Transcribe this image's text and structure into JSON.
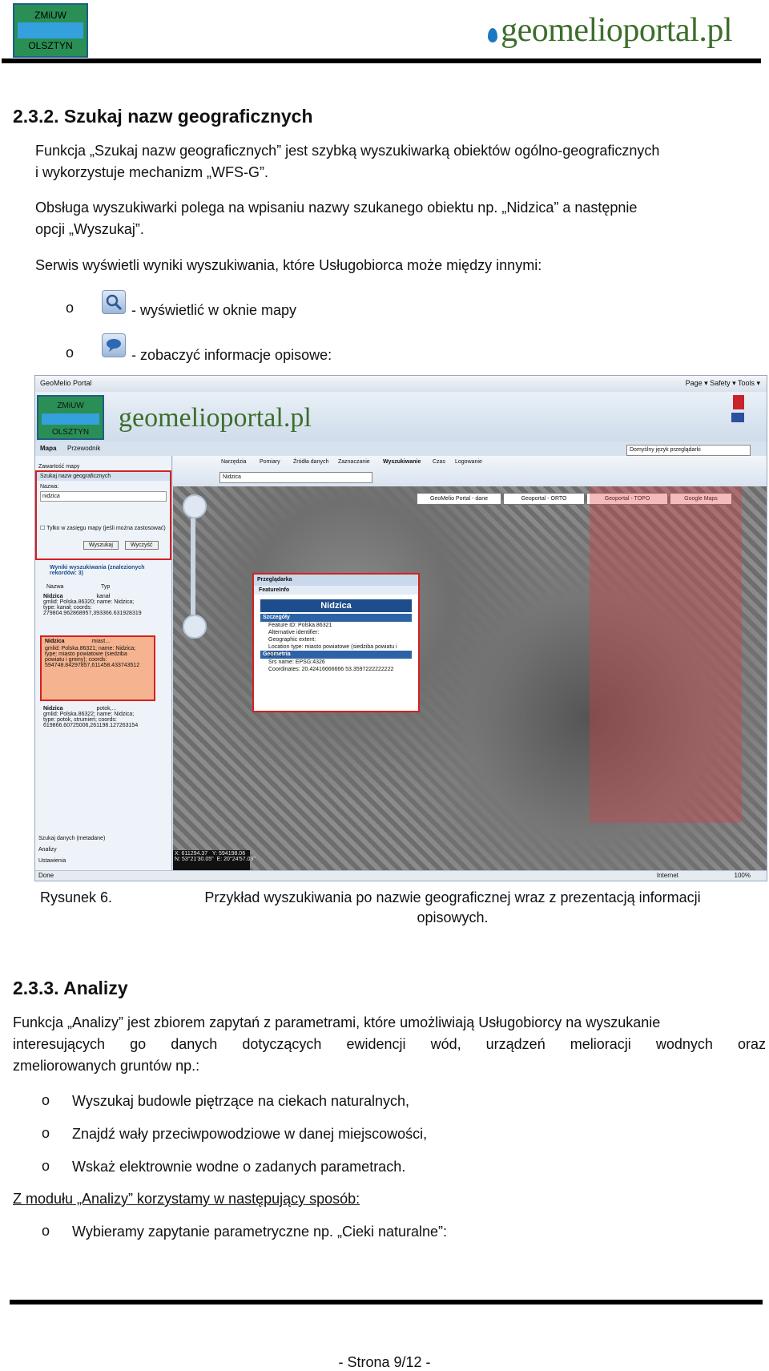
{
  "header": {
    "logo_line1": "ZMiUW",
    "logo_line2": "OLSZTYN",
    "brand": "geomelioportal.pl"
  },
  "section1": {
    "heading": "2.3.2. Szukaj nazw geograficznych",
    "para1_line1": "Funkcja „Szukaj nazw geograficznych” jest szybką wyszukiwarką obiektów ogólno-geograficznych",
    "para1_line2": "i wykorzystuje mechanizm „WFS-G”.",
    "para2_line1": "Obsługa wyszukiwarki polega na wpisaniu nazwy szukanego obiektu np. „Nidzica” a następnie",
    "para2_line2": "opcji „Wyszukaj”.",
    "para3": "Serwis wyświetli wyniki wyszukiwania, które Usługobiorca może między innymi:",
    "bullet_marker": "o",
    "bullet1": "- wyświetlić w oknie mapy",
    "bullet2": "- zobaczyć informacje opisowe:"
  },
  "figure": {
    "window_title": "GeoMelio Portal",
    "ie_menu": "Page ▾  Safety ▾  Tools ▾",
    "tab_map": "Mapa",
    "tab_guide": "Przewodnik",
    "toolbar_tabs": [
      "Narzędzia",
      "Pomiary",
      "Źródła danych",
      "Zaznaczanie",
      "Wyszukiwanie",
      "Czas",
      "Logowanie"
    ],
    "language": "Domyślny język przeglądarki",
    "search_value": "Nidzica",
    "sidebar_title1": "Zawartość mapy",
    "sidebar_title2": "Szukaj nazw geograficznych",
    "name_label": "Nazwa:",
    "name_value": "nidzica",
    "checkbox_label": "Tylko w zasięgu mapy (jeśli można zastosować)",
    "btn_search": "Wyszukaj",
    "btn_clear": "Wyczyść",
    "results_title": "Wyniki wyszukiwania (znalezionych rekordów: 3)",
    "col_name": "Nazwa",
    "col_type": "Typ",
    "results": [
      {
        "name": "Nidzica",
        "type": "kanał",
        "l1": "gmlid: Polska.86320; name: Nidzica;",
        "l2": "type: kanał; coords:",
        "l3": "279804.962868957,393366.631928319"
      },
      {
        "name": "Nidzica",
        "type": "miast...",
        "l1": "gmlid: Polska.86321; name: Nidzica;",
        "l2": "type: miasto powiatowe (siedziba",
        "l3": "powiatu i gminy); coords:",
        "l4": "594748.84297857,611458.433743512"
      },
      {
        "name": "Nidzica",
        "type": "potok,...",
        "l1": "gmlid: Polska.86322; name: Nidzica;",
        "l2": "type: potok, strumień; coords:",
        "l3": "619866.60725006,261198.127263154"
      }
    ],
    "sidebar_bottom": [
      "Szukaj danych (metadane)",
      "Analizy",
      "Ustawienia"
    ],
    "map_links": [
      "GeoMelio Portal - dane",
      "Geoportal - ORTO",
      "Geoportal - TOPO",
      "Google Maps"
    ],
    "popup_title": "Przeglądarka",
    "popup_tab": "FeatureInfo",
    "popup_feature": "Nidzica",
    "popup_sec1": "Szczegóły",
    "popup_rows1": [
      "Feature ID: Polska.86321",
      "Alternative identifier:",
      "Geographic extent:",
      "Location type: miasto powiatowe (siedziba powiatu i gminy)"
    ],
    "popup_sec2": "Geometria",
    "popup_rows2": [
      "Srs name: EPSG:4326",
      "Coordinates: 20.42416666666 53.3597222222222"
    ],
    "coords": "X: 611294.37   Y: 594198.06\nN: 53°21'30.05\"  E: 20°24'57.03\"",
    "status_done": "Done",
    "status_zone": "Internet",
    "status_zoom": "100%"
  },
  "caption": {
    "label": "Rysunek 6.",
    "text_line1": "Przykład wyszukiwania po nazwie geograficznej wraz z prezentacją informacji",
    "text_line2": "opisowych."
  },
  "section2": {
    "heading": "2.3.3. Analizy",
    "para_line1": "Funkcja „Analizy” jest zbiorem zapytań z parametrami, które umożliwiają Usługobiorcy na  wyszukanie",
    "para_line2": "interesujących go danych dotyczących ewidencji wód, urządzeń melioracji wodnych oraz",
    "para_line3": "zmeliorowanych gruntów np.:",
    "bullets": [
      "Wyszukaj budowle piętrzące na ciekach naturalnych,",
      "Znajdź wały przeciwpowodziowe w danej miejscowości,",
      "Wskaż elektrownie wodne o zadanych parametrach."
    ],
    "usage": "Z modułu „Analizy” korzystamy w następujący sposób:",
    "usage_bullet": "Wybieramy zapytanie parametryczne np. „Cieki naturalne”:"
  },
  "footer": {
    "page": "- Strona 9/12 -"
  }
}
